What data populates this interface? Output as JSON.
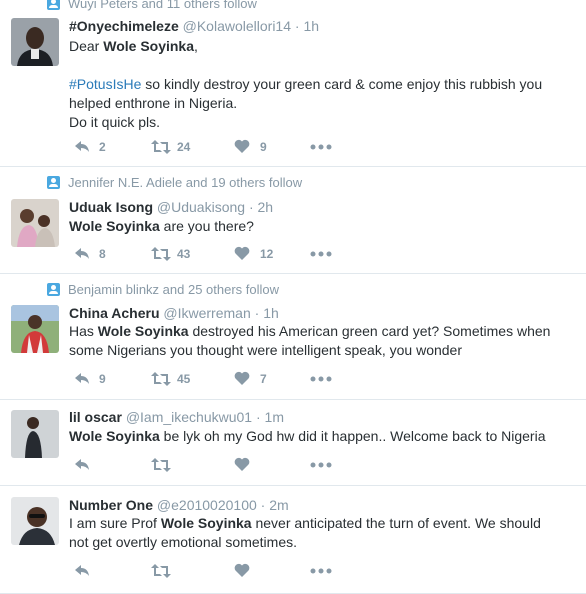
{
  "tweets": [
    {
      "follow_context": "Wuyi Peters and 11 others follow",
      "name": "#Onyechimeleze",
      "handle": "@Kolawolellori14",
      "time": "1h",
      "body": {
        "line1_pre": "Dear ",
        "line1_bold": "Wole Soyinka",
        "line1_post": ",",
        "hashtag": "#PotusIsHe",
        "line2_post": " so kindly destroy your green card & come enjoy this rubbish you",
        "line3": "helped enthrone in Nigeria.",
        "line4": "Do it quick pls."
      },
      "replies": "2",
      "retweets": "24",
      "likes": "9"
    },
    {
      "follow_context": "Jennifer N.E. Adiele and 19 others follow",
      "name": "Uduak Isong",
      "handle": "@Uduakisong",
      "time": "2h",
      "body": {
        "bold": "Wole Soyinka",
        "post": " are you there?"
      },
      "replies": "8",
      "retweets": "43",
      "likes": "12"
    },
    {
      "follow_context": "Benjamin blinkz and 25 others follow",
      "name": "China Acheru",
      "handle": "@Ikwerreman",
      "time": "1h",
      "body": {
        "pre": "Has ",
        "bold": "Wole Soyinka",
        "post": " destroyed his American green card yet? Sometimes when",
        "line2": "some Nigerians you thought were intelligent speak, you wonder"
      },
      "replies": "9",
      "retweets": "45",
      "likes": "7"
    },
    {
      "name": "lil oscar",
      "handle": "@Iam_ikechukwu01",
      "time": "1m",
      "body": {
        "bold": "Wole Soyinka",
        "post": " be lyk oh my God hw did it happen.. Welcome back to Nigeria"
      }
    },
    {
      "name": "Number One",
      "handle": "@e2010020100",
      "time": "2m",
      "body": {
        "pre": "I am sure Prof ",
        "bold": "Wole Soyinka",
        "post": " never anticipated the turn of event. We should",
        "line2": "not get overtly emotional sometimes."
      }
    }
  ],
  "header_separator": "·",
  "icons": {
    "reply": "reply-icon",
    "retweet": "retweet-icon",
    "like": "heart-icon",
    "more": "more-icon",
    "follow": "follow-context-icon"
  },
  "colors": {
    "muted": "#8899a6",
    "link": "#2b7bb9",
    "text": "#292f33",
    "border": "#e1e8ed"
  }
}
